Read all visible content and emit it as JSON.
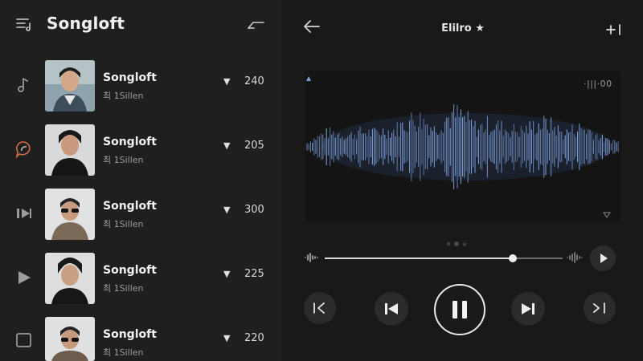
{
  "app": {
    "title": "Songloft"
  },
  "sidebar": {
    "rail": [
      {
        "icon": "music-note-icon"
      },
      {
        "icon": "chat-bubble-icon"
      },
      {
        "icon": "skip-to-end-icon"
      },
      {
        "icon": "play-icon"
      },
      {
        "icon": "square-icon"
      }
    ]
  },
  "songs": [
    {
      "title": "Songloft",
      "subtitle": "최 1Sillen",
      "arrow": "▼",
      "count": "240"
    },
    {
      "title": "Songloft",
      "subtitle": "최 1Sillen",
      "arrow": "▼",
      "count": "205"
    },
    {
      "title": "Songloft",
      "subtitle": "최 1Sillen",
      "arrow": "▼",
      "count": "300"
    },
    {
      "title": "Songloft",
      "subtitle": "최 1Sillen",
      "arrow": "▼",
      "count": "225"
    },
    {
      "title": "Songloft",
      "subtitle": "최 1Sillen",
      "arrow": "▼",
      "count": "220"
    }
  ],
  "now_playing": {
    "title": "Elilro ★",
    "time_readout": "·|||·00",
    "progress": 0.79
  },
  "controls": {
    "shuffle": "shuffle-icon",
    "previous": "previous-icon",
    "pause": "pause-icon",
    "next": "next-icon",
    "repeat": "repeat-icon"
  },
  "colors": {
    "waveform": "#7fa2df",
    "background": "#1b1b1b",
    "panel": "#1f1f1f"
  }
}
